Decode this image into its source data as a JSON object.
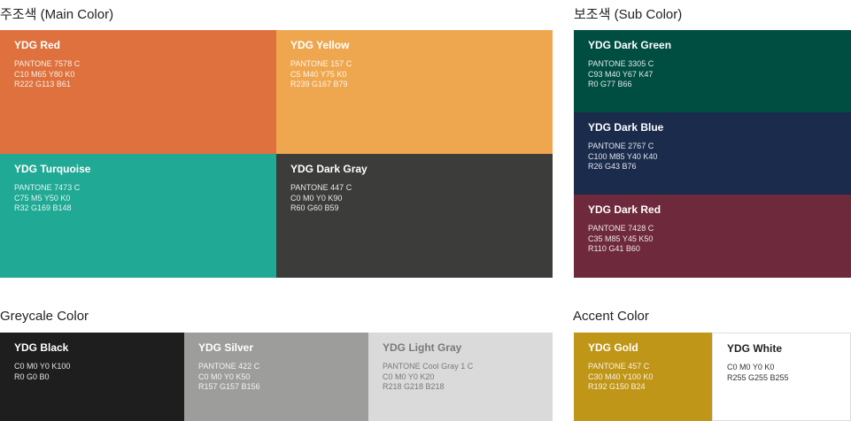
{
  "sections": {
    "main": {
      "title": "주조색 (Main Color)"
    },
    "sub": {
      "title": "보조색 (Sub Color)"
    },
    "grey": {
      "title": "Greycale Color"
    },
    "accent": {
      "title": "Accent Color"
    }
  },
  "swatches": {
    "red": {
      "name": "YDG Red",
      "lines": [
        "PANTONE 7578 C",
        "C10 M65 Y80 K0",
        "R222 G113 B61"
      ],
      "color": "#DE713D"
    },
    "yellow": {
      "name": "YDG Yellow",
      "lines": [
        "PANTONE 157 C",
        "C5 M40 Y75 K0",
        "R239 G167 B79"
      ],
      "color": "#EFA74F"
    },
    "turquoise": {
      "name": "YDG Turquoise",
      "lines": [
        "PANTONE 7473 C",
        "C75 M5 Y50 K0",
        "R32 G169 B148"
      ],
      "color": "#20A994"
    },
    "darkgray": {
      "name": "YDG Dark Gray",
      "lines": [
        "PANTONE 447 C",
        "C0 M0 Y0 K90",
        "R60 G60 B59"
      ],
      "color": "#3C3C3B"
    },
    "darkgreen": {
      "name": "YDG Dark Green",
      "lines": [
        "PANTONE 3305 C",
        "C93 M40 Y67 K47",
        "R0 G77 B66"
      ],
      "color": "#004D42"
    },
    "darkblue": {
      "name": "YDG Dark Blue",
      "lines": [
        "PANTONE 2767 C",
        "C100 M85 Y40 K40",
        "R26 G43 B76"
      ],
      "color": "#1A2B4C"
    },
    "darkred": {
      "name": "YDG Dark Red",
      "lines": [
        "PANTONE 7428 C",
        "C35 M85 Y45 K50",
        "R110 G41 B60"
      ],
      "color": "#6E293C"
    },
    "black": {
      "name": "YDG Black",
      "lines": [
        "C0 M0 Y0 K100",
        "R0 G0 B0"
      ],
      "color": "#1E1E1E"
    },
    "silver": {
      "name": "YDG Silver",
      "lines": [
        "PANTONE 422 C",
        "C0 M0 Y0 K50",
        "R157 G157 B156"
      ],
      "color": "#9D9D9C"
    },
    "lightgray": {
      "name": "YDG Light Gray",
      "lines": [
        "PANTONE Cool Gray 1 C",
        "C0 M0 Y0 K20",
        "R218 G218 B218"
      ],
      "color": "#DADADA"
    },
    "gold": {
      "name": "YDG Gold",
      "lines": [
        "PANTONE 457 C",
        "C30 M40 Y100 K0",
        "R192 G150 B24"
      ],
      "color": "#C09618"
    },
    "white": {
      "name": "YDG White",
      "lines": [
        "C0 M0 Y0 K0",
        "R255 G255 B255"
      ],
      "color": "#FFFFFF"
    }
  }
}
